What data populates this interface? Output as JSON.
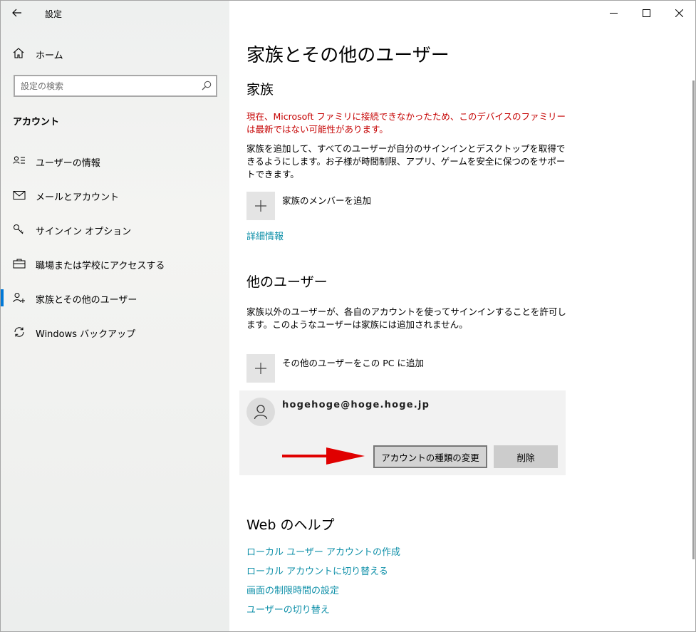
{
  "window": {
    "title": "設定"
  },
  "sidebar": {
    "home_label": "ホーム",
    "search_placeholder": "設定の検索",
    "section_title": "アカウント",
    "items": [
      {
        "label": "ユーザーの情報",
        "icon": "user-info-icon"
      },
      {
        "label": "メールとアカウント",
        "icon": "mail-icon"
      },
      {
        "label": "サインイン オプション",
        "icon": "key-icon"
      },
      {
        "label": "職場または学校にアクセスする",
        "icon": "briefcase-icon"
      },
      {
        "label": "家族とその他のユーザー",
        "icon": "person-add-icon",
        "active": true
      },
      {
        "label": "Windows バックアップ",
        "icon": "sync-icon"
      }
    ]
  },
  "main": {
    "page_title": "家族とその他のユーザー",
    "family": {
      "heading": "家族",
      "warning": "現在、Microsoft ファミリに接続できなかったため、このデバイスのファミリーは最新ではない可能性があります。",
      "description": "家族を追加して、すべてのユーザーが自分のサインインとデスクトップを取得できるようにします。お子様が時間制限、アプリ、ゲームを安全に保つのをサポートできます。",
      "add_label": "家族のメンバーを追加",
      "more_info_link": "詳細情報"
    },
    "others": {
      "heading": "他のユーザー",
      "description": "家族以外のユーザーが、各自のアカウントを使ってサインインすることを許可します。このようなユーザーは家族には追加されません。",
      "add_label": "その他のユーザーをこの PC に追加",
      "user": {
        "email": "hogehoge@hoge.hoge.jp",
        "change_type_button": "アカウントの種類の変更",
        "delete_button": "削除"
      }
    },
    "web_help": {
      "heading": "Web のヘルプ",
      "links": [
        "ローカル ユーザー アカウントの作成",
        "ローカル アカウントに切り替える",
        "画面の制限時間の設定",
        "ユーザーの切り替え"
      ]
    }
  },
  "colors": {
    "accent": "#0078d7",
    "link": "#0d8fa8",
    "warning": "#c50000",
    "annotation_arrow": "#e00000"
  }
}
